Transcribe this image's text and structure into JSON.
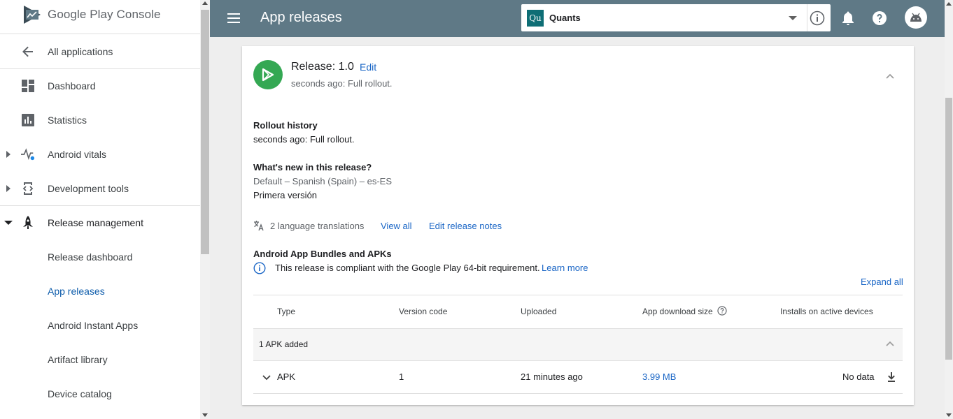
{
  "sidebar": {
    "logo_text": "Google Play Console",
    "back_label": "All applications",
    "items": [
      {
        "label": "Dashboard"
      },
      {
        "label": "Statistics"
      },
      {
        "label": "Android vitals"
      },
      {
        "label": "Development tools"
      },
      {
        "label": "Release management"
      },
      {
        "label": "Release dashboard"
      },
      {
        "label": "App releases"
      },
      {
        "label": "Android Instant Apps"
      },
      {
        "label": "Artifact library"
      },
      {
        "label": "Device catalog"
      }
    ]
  },
  "topbar": {
    "title": "App releases",
    "app_icon_text": "Qu",
    "app_name": "Quants"
  },
  "release": {
    "title": "Release: 1.0",
    "edit_label": "Edit",
    "subtitle": "seconds ago: Full rollout.",
    "rollout_history_heading": "Rollout history",
    "rollout_history_text": "seconds ago: Full rollout.",
    "whats_new_heading": "What's new in this release?",
    "language_line": "Default – Spanish (Spain) – es-ES",
    "notes_text": "Primera versión",
    "translations_label": "2 language translations",
    "view_all_label": "View all",
    "edit_notes_label": "Edit release notes",
    "bundles_heading": "Android App Bundles and APKs",
    "compliance_text": "This release is compliant with the Google Play 64-bit requirement.",
    "learn_more_label": "Learn more",
    "expand_all_label": "Expand all"
  },
  "table": {
    "headers": [
      "Type",
      "Version code",
      "Uploaded",
      "App download size",
      "Installs on active devices"
    ],
    "group_label": "1 APK added",
    "rows": [
      {
        "type": "APK",
        "version_code": "1",
        "uploaded": "21 minutes ago",
        "size": "3.99 MB",
        "installs": "No data"
      }
    ]
  },
  "colors": {
    "topbar": "#5f7986",
    "link": "#1a66c6",
    "active_nav": "#0d5cab",
    "release_icon": "#34a853"
  }
}
